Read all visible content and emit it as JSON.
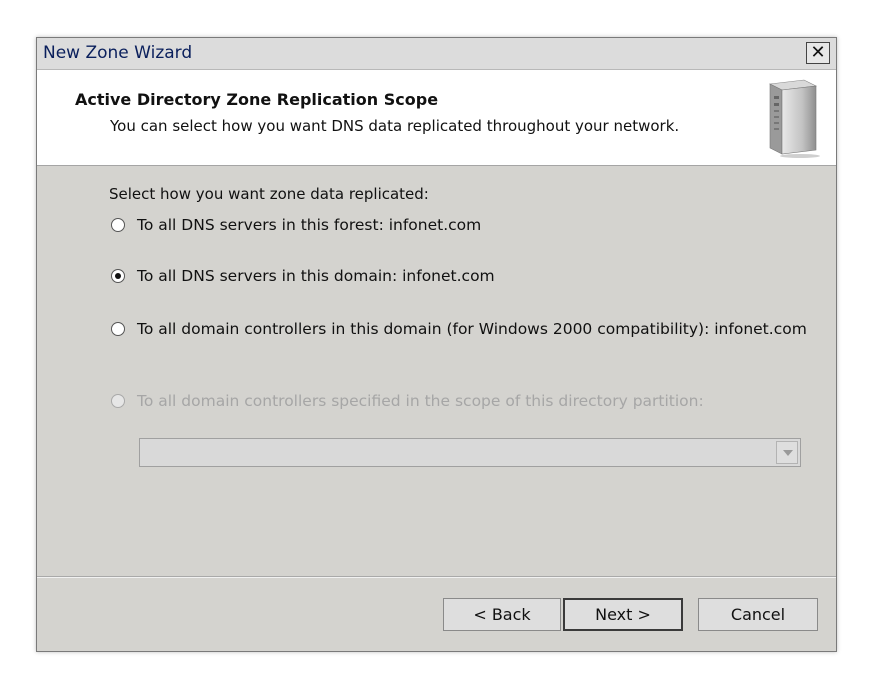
{
  "window": {
    "title": "New Zone Wizard",
    "close_glyph": "✕"
  },
  "header": {
    "title": "Active Directory Zone Replication Scope",
    "subtitle": "You can select how you want DNS data replicated throughout your network.",
    "icon": "server-tower-icon"
  },
  "content": {
    "prompt": "Select how you want zone data replicated:",
    "options": [
      {
        "label": "To all DNS servers in this forest: infonet.com",
        "checked": false,
        "enabled": true
      },
      {
        "label": "To all DNS servers in this domain: infonet.com",
        "checked": true,
        "enabled": true
      },
      {
        "label": "To all domain controllers in this domain (for Windows 2000 compatibility): infonet.com",
        "checked": false,
        "enabled": true
      },
      {
        "label": "To all domain controllers specified in the scope of this directory partition:",
        "checked": false,
        "enabled": false
      }
    ],
    "partition_select": {
      "value": "",
      "enabled": false
    }
  },
  "buttons": {
    "back": "< Back",
    "next": "Next >",
    "cancel": "Cancel"
  }
}
